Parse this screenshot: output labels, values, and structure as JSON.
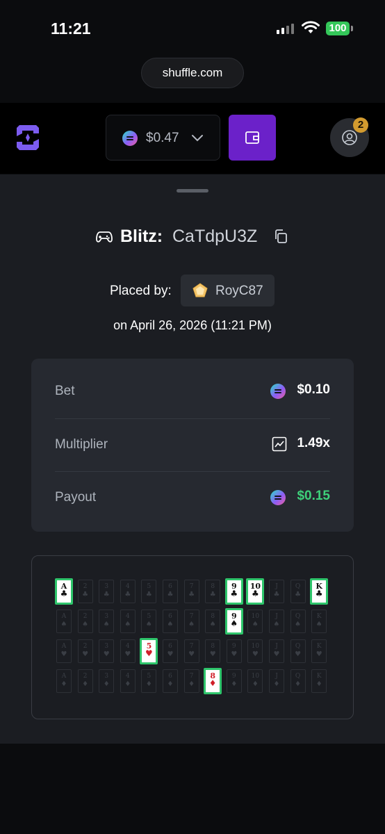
{
  "status_bar": {
    "time": "11:21",
    "battery": "100"
  },
  "browser": {
    "url": "shuffle.com"
  },
  "header": {
    "balance": "$0.47",
    "notification_count": "2",
    "colors": {
      "wallet": "#6b21c9",
      "badge": "#d39b2f"
    }
  },
  "bet": {
    "game": "Blitz:",
    "id": "CaTdpU3Z",
    "placed_by_label": "Placed by:",
    "user": "RoyC87",
    "date": "on April 26, 2026 (11:21 PM)"
  },
  "details": [
    {
      "label": "Bet",
      "value": "$0.10",
      "icon": "coin-icon"
    },
    {
      "label": "Multiplier",
      "value": "1.49x",
      "icon": "multiplier-icon"
    },
    {
      "label": "Payout",
      "value": "$0.15",
      "icon": "coin-icon",
      "color": "#3ed17a"
    }
  ],
  "card_grid": {
    "ranks": [
      "A",
      "2",
      "3",
      "4",
      "5",
      "6",
      "7",
      "8",
      "9",
      "10",
      "J",
      "Q",
      "K"
    ],
    "suits": [
      "♣",
      "♠",
      "♥",
      "♦"
    ],
    "selected": [
      {
        "rank": "A",
        "suit": "♣"
      },
      {
        "rank": "9",
        "suit": "♣"
      },
      {
        "rank": "10",
        "suit": "♣"
      },
      {
        "rank": "K",
        "suit": "♣"
      },
      {
        "rank": "9",
        "suit": "♠"
      },
      {
        "rank": "5",
        "suit": "♥"
      },
      {
        "rank": "8",
        "suit": "♦"
      }
    ],
    "highlight_color": "#2ec56b"
  }
}
